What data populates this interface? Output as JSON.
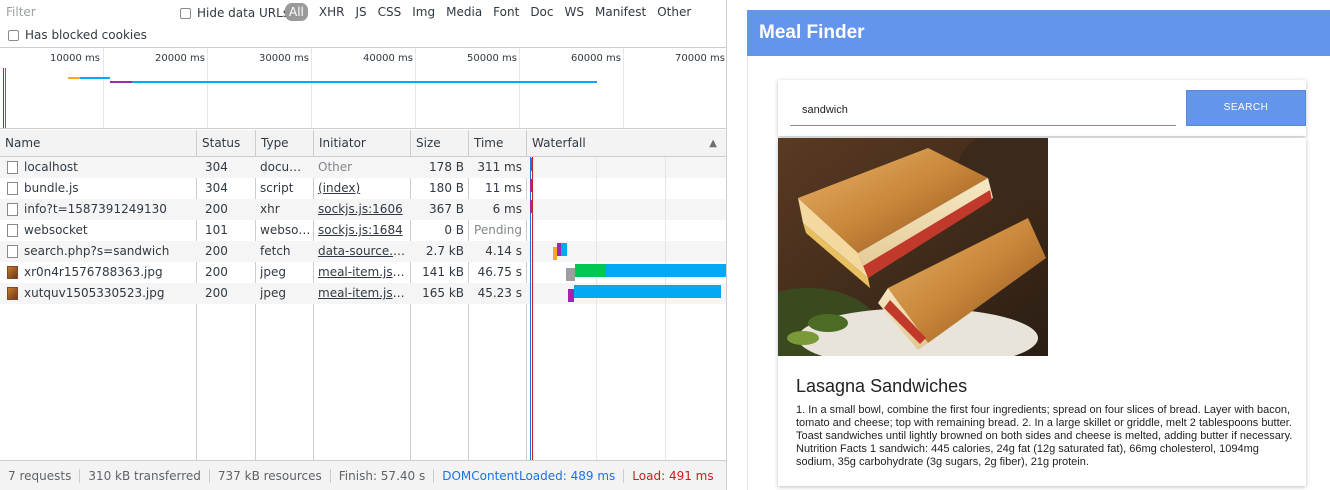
{
  "devtools": {
    "filter": {
      "placeholder": "Filter",
      "value": ""
    },
    "hide_data_urls_label": "Hide data URLs",
    "type_filters": [
      "All",
      "XHR",
      "JS",
      "CSS",
      "Img",
      "Media",
      "Font",
      "Doc",
      "WS",
      "Manifest",
      "Other"
    ],
    "active_type_filter": "All",
    "has_blocked_cookies_label": "Has blocked cookies",
    "overview_ticks": [
      "10000 ms",
      "20000 ms",
      "30000 ms",
      "40000 ms",
      "50000 ms",
      "60000 ms",
      "70000 ms"
    ],
    "columns": {
      "name": "Name",
      "status": "Status",
      "type": "Type",
      "initiator": "Initiator",
      "size": "Size",
      "time": "Time",
      "waterfall": "Waterfall"
    },
    "sort_indicator": "▲",
    "requests": [
      {
        "name": "localhost",
        "status": "304",
        "type": "docum...",
        "initiator": "Other",
        "initiator_link": false,
        "size": "178 B",
        "time": "311 ms",
        "icon": "document-icon"
      },
      {
        "name": "bundle.js",
        "status": "304",
        "type": "script",
        "initiator": "(index)",
        "initiator_link": true,
        "size": "180 B",
        "time": "11 ms",
        "icon": "document-icon"
      },
      {
        "name": "info?t=1587391249130",
        "status": "200",
        "type": "xhr",
        "initiator": "sockjs.js:1606",
        "initiator_link": true,
        "size": "367 B",
        "time": "6 ms",
        "icon": "document-icon"
      },
      {
        "name": "websocket",
        "status": "101",
        "type": "websoc...",
        "initiator": "sockjs.js:1684",
        "initiator_link": true,
        "size": "0 B",
        "time": "Pending",
        "icon": "document-icon"
      },
      {
        "name": "search.php?s=sandwich",
        "status": "200",
        "type": "fetch",
        "initiator": "data-source.js:...",
        "initiator_link": true,
        "size": "2.7 kB",
        "time": "4.14 s",
        "icon": "document-icon"
      },
      {
        "name": "xr0n4r1576788363.jpg",
        "status": "200",
        "type": "jpeg",
        "initiator": "meal-item.js:13",
        "initiator_link": true,
        "size": "141 kB",
        "time": "46.75 s",
        "icon": "image-icon"
      },
      {
        "name": "xutquv1505330523.jpg",
        "status": "200",
        "type": "jpeg",
        "initiator": "meal-item.js:13",
        "initiator_link": true,
        "size": "165 kB",
        "time": "45.23 s",
        "icon": "image-icon"
      }
    ],
    "status_bar": {
      "requests": "7 requests",
      "transferred": "310 kB transferred",
      "resources": "737 kB resources",
      "finish": "Finish: 57.40 s",
      "dom_content_loaded": "DOMContentLoaded: 489 ms",
      "load": "Load: 491 ms"
    },
    "colors": {
      "dcl": "#1a73e8",
      "load": "#c5221f",
      "waterfall_download": "#03a9f4",
      "waterfall_wait": "#00c853",
      "waterfall_queue": "#9e9e9e"
    }
  },
  "app": {
    "title": "Meal Finder",
    "search": {
      "value": "sandwich",
      "placeholder": ""
    },
    "search_button": "SEARCH",
    "meal": {
      "title": "Lasagna Sandwiches",
      "description": "1. In a small bowl, combine the first four ingredients; spread on four slices of bread. Layer with bacon, tomato and cheese; top with remaining bread. 2. In a large skillet or griddle, melt 2 tablespoons butter. Toast sandwiches until lightly browned on both sides and cheese is melted, adding butter if necessary. Nutrition Facts 1 sandwich: 445 calories, 24g fat (12g saturated fat), 66mg cholesterol, 1094mg sodium, 35g carbohydrate (3g sugars, 2g fiber), 21g protein."
    },
    "colors": {
      "header": "#6495ed",
      "button": "#6495ed"
    }
  }
}
